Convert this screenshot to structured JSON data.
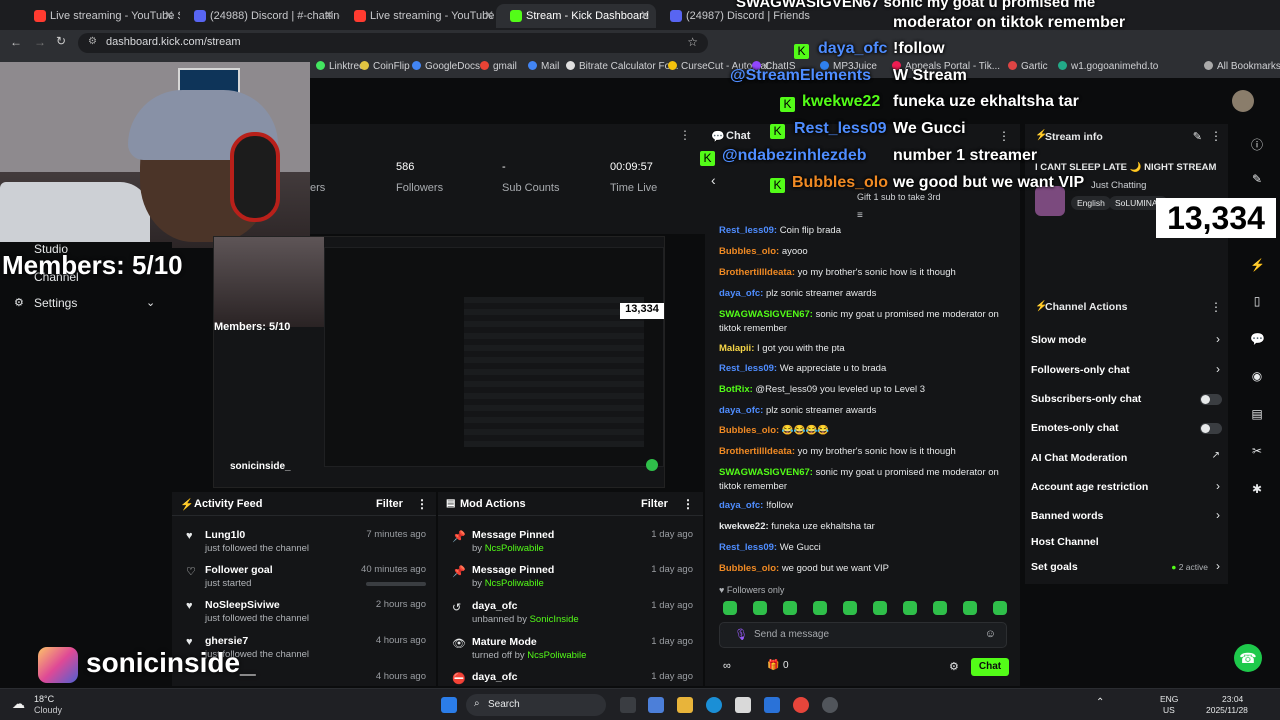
{
  "browser": {
    "tabs": [
      {
        "title": "Live streaming - YouTube Studio",
        "color": "#ff3b30"
      },
      {
        "title": "(24988) Discord | #-chatting | N",
        "color": "#5865f2"
      },
      {
        "title": "Live streaming - YouTube Studio",
        "color": "#ff3b30"
      },
      {
        "title": "Stream - Kick Dashboard",
        "color": "#53fc18"
      },
      {
        "title": "(24987) Discord | Friends",
        "color": "#5865f2"
      }
    ],
    "url": "dashboard.kick.com/stream",
    "bookmarks": [
      "Linktree",
      "CoinFlip",
      "GoogleDocs",
      "gmail",
      "Mail",
      "Bitrate Calculator Fo...",
      "CurseCut - Automat...",
      "ChatIS",
      "MP3Juice",
      "Appeals Portal - Tik...",
      "Gartic",
      "w1.gogoanimehd.to"
    ],
    "all_bookmarks": "All Bookmarks"
  },
  "dashboard": {
    "stats": [
      {
        "value": "586",
        "label": "Followers"
      },
      {
        "value": "-",
        "label": "Sub Counts"
      },
      {
        "value": "00:09:57",
        "label": "Time Live"
      }
    ],
    "partial_label": "ers",
    "nav": {
      "studio": "Studio",
      "channel": "Channel",
      "settings": "Settings"
    }
  },
  "activity_feed": {
    "title": "Activity Feed",
    "filter": "Filter",
    "items": [
      {
        "name": "Lung1l0",
        "sub": "just followed the channel",
        "time": "7 minutes ago"
      },
      {
        "name": "Follower goal",
        "sub": "just started",
        "time": "40 minutes ago"
      },
      {
        "name": "NoSleepSiviwe",
        "sub": "just followed the channel",
        "time": "2 hours ago"
      },
      {
        "name": "ghersie7",
        "sub": "just followed the channel",
        "time": "4 hours ago"
      },
      {
        "name": "",
        "sub": "",
        "time": "4 hours ago"
      }
    ]
  },
  "mod_actions": {
    "title": "Mod Actions",
    "filter": "Filter",
    "items": [
      {
        "name": "Message Pinned",
        "by": "by",
        "user": "NcsPoliwabile",
        "time": "1 day ago"
      },
      {
        "name": "Message Pinned",
        "by": "by",
        "user": "NcsPoliwabile",
        "time": "1 day ago"
      },
      {
        "name": "daya_ofc",
        "by": "unbanned by",
        "user": "SonicInside",
        "time": "1 day ago"
      },
      {
        "name": "Mature Mode",
        "by": "turned off by",
        "user": "NcsPoliwabile",
        "time": "1 day ago"
      },
      {
        "name": "daya_ofc",
        "by": "",
        "user": "",
        "time": "1 day ago"
      }
    ]
  },
  "chat": {
    "title": "Chat",
    "pinned_sub": "Gift 1 sub to take 3rd",
    "messages": [
      {
        "user": "Rest_less09",
        "color": "#4f8dff",
        "text": "Coin flip brada"
      },
      {
        "user": "Bubbles_olo",
        "color": "#f08a24",
        "text": "ayooo"
      },
      {
        "user": "Brothertillldeata",
        "color": "#f08a24",
        "text": "yo my brother's sonic how is it though"
      },
      {
        "user": "daya_ofc",
        "color": "#4f8dff",
        "text": "plz sonic streamer awards"
      },
      {
        "user": "SWAGWASIGVEN67",
        "color": "#53fc18",
        "text": "sonic my goat u promised me moderator on tiktok remember"
      },
      {
        "user": "Malapii",
        "color": "#f5d547",
        "text": "I got you with the pta"
      },
      {
        "user": "Rest_less09",
        "color": "#4f8dff",
        "text": "We appreciate u to brada"
      },
      {
        "user": "BotRix",
        "color": "#53fc18",
        "text": "@Rest_less09 you leveled up to Level 3"
      },
      {
        "user": "daya_ofc",
        "color": "#4f8dff",
        "text": "plz sonic streamer awards"
      },
      {
        "user": "Bubbles_olo",
        "color": "#f08a24",
        "text": "😂😂😂😂"
      },
      {
        "user": "Brothertillldeata",
        "color": "#f08a24",
        "text": "yo my brother's sonic how is it though"
      },
      {
        "user": "SWAGWASIGVEN67",
        "color": "#53fc18",
        "text": "sonic my goat u promised me moderator on tiktok remember"
      },
      {
        "user": "daya_ofc",
        "color": "#4f8dff",
        "text": "!follow"
      },
      {
        "user": "kwekwe22",
        "color": "#e7e9ea",
        "text": "funeka uze ekhaltsha tar"
      },
      {
        "user": "Rest_less09",
        "color": "#4f8dff",
        "text": "We Gucci"
      },
      {
        "user": "Bubbles_olo",
        "color": "#f08a24",
        "text": "we good but we want VIP"
      }
    ],
    "followers_only": "Followers only",
    "input_placeholder": "Send a message",
    "counter": "0",
    "send": "Chat"
  },
  "stream_info": {
    "title": "Stream info",
    "stream_title": "I CANT SLEEP LATE 🌙 NIGHT STREAM",
    "category": "Just Chatting",
    "language": "English",
    "tag": "SoLUMINAT"
  },
  "channel_actions": {
    "title": "Channel Actions",
    "items": [
      {
        "label": "Slow mode",
        "control": "chevron"
      },
      {
        "label": "Followers-only chat",
        "control": "chevron"
      },
      {
        "label": "Subscribers-only chat",
        "control": "toggle"
      },
      {
        "label": "Emotes-only chat",
        "control": "toggle"
      },
      {
        "label": "AI Chat Moderation",
        "control": "external"
      },
      {
        "label": "Account age restriction",
        "control": "chevron"
      },
      {
        "label": "Banned words",
        "control": "chevron"
      },
      {
        "label": "Host Channel",
        "control": "none"
      },
      {
        "label": "Set goals",
        "control": "chevron"
      }
    ],
    "goals_active": "2 active"
  },
  "overlay": {
    "members": "Members: 5/10",
    "viewer_count": "13,334",
    "ig_handle": "sonicinside_",
    "chat_lines": [
      {
        "user": "",
        "text": "moderator on tiktok remember",
        "ucolor": "#53fc18"
      },
      {
        "user": "daya_ofc",
        "text": "!follow",
        "ucolor": "#4f8dff"
      },
      {
        "user": "@StreamElements",
        "text": "W Stream",
        "ucolor": "#4f8dff"
      },
      {
        "user": "kwekwe22",
        "text": "funeka uze ekhaltsha tar",
        "ucolor": "#53fc18"
      },
      {
        "user": "Rest_less09",
        "text": "We Gucci",
        "ucolor": "#4f8dff"
      },
      {
        "user": "@ndabezinhlezdeb",
        "text": "number 1 streamer",
        "ucolor": "#4f8dff"
      },
      {
        "user": "Bubbles_olo",
        "text": "we good but we want VIP",
        "ucolor": "#f08a24"
      }
    ],
    "top_partial": "SWAGWASIGVEN67   sonic my goat u promised me"
  },
  "taskbar": {
    "weather_temp": "18°C",
    "weather_desc": "Cloudy",
    "search": "Search",
    "lang": "ENG",
    "region": "US",
    "time": "23:04",
    "date": "2025/11/28"
  },
  "colors": {
    "accent": "#53fc18",
    "panel": "#141517",
    "bg": "#0b0c0d"
  }
}
